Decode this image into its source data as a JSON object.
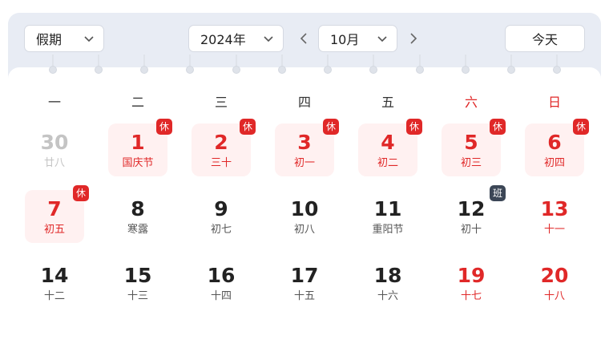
{
  "toolbar": {
    "holiday_select": "假期",
    "year_select": "2024年",
    "month_select": "10月",
    "today_label": "今天"
  },
  "weekdays": [
    "一",
    "二",
    "三",
    "四",
    "五",
    "六",
    "日"
  ],
  "colors": {
    "accent_red": "#e02828",
    "rest_bg": "#fff1f1",
    "work_badge": "#3c4656"
  },
  "weeks": [
    [
      {
        "day": "30",
        "lunar": "廿八",
        "type": "faded"
      },
      {
        "day": "1",
        "lunar": "国庆节",
        "type": "rest",
        "badge": "休"
      },
      {
        "day": "2",
        "lunar": "三十",
        "type": "rest",
        "badge": "休"
      },
      {
        "day": "3",
        "lunar": "初一",
        "type": "rest",
        "badge": "休"
      },
      {
        "day": "4",
        "lunar": "初二",
        "type": "rest",
        "badge": "休"
      },
      {
        "day": "5",
        "lunar": "初三",
        "type": "rest",
        "badge": "休"
      },
      {
        "day": "6",
        "lunar": "初四",
        "type": "rest",
        "badge": "休"
      }
    ],
    [
      {
        "day": "7",
        "lunar": "初五",
        "type": "rest",
        "badge": "休"
      },
      {
        "day": "8",
        "lunar": "寒露",
        "type": "normal"
      },
      {
        "day": "9",
        "lunar": "初七",
        "type": "normal"
      },
      {
        "day": "10",
        "lunar": "初八",
        "type": "normal"
      },
      {
        "day": "11",
        "lunar": "重阳节",
        "type": "normal"
      },
      {
        "day": "12",
        "lunar": "初十",
        "type": "normal",
        "badge": "班"
      },
      {
        "day": "13",
        "lunar": "十一",
        "type": "red"
      }
    ],
    [
      {
        "day": "14",
        "lunar": "十二",
        "type": "normal"
      },
      {
        "day": "15",
        "lunar": "十三",
        "type": "normal"
      },
      {
        "day": "16",
        "lunar": "十四",
        "type": "normal"
      },
      {
        "day": "17",
        "lunar": "十五",
        "type": "normal"
      },
      {
        "day": "18",
        "lunar": "十六",
        "type": "normal"
      },
      {
        "day": "19",
        "lunar": "十七",
        "type": "red"
      },
      {
        "day": "20",
        "lunar": "十八",
        "type": "red"
      }
    ]
  ]
}
